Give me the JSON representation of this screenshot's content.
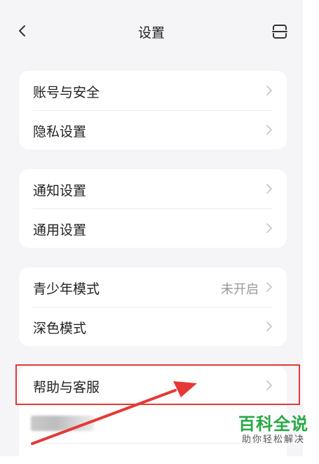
{
  "header": {
    "title": "设置",
    "back_icon": "chevron-left-icon",
    "scan_icon": "scan-icon"
  },
  "groups": [
    {
      "items": [
        {
          "label": "账号与安全",
          "value": ""
        },
        {
          "label": "隐私设置",
          "value": ""
        }
      ]
    },
    {
      "items": [
        {
          "label": "通知设置",
          "value": ""
        },
        {
          "label": "通用设置",
          "value": ""
        }
      ]
    },
    {
      "items": [
        {
          "label": "青少年模式",
          "value": "未开启"
        },
        {
          "label": "深色模式",
          "value": ""
        }
      ]
    },
    {
      "items": [
        {
          "label": "帮助与客服",
          "value": ""
        }
      ]
    }
  ],
  "annotation": {
    "highlight_color": "#e53935",
    "arrow_color": "#e53935"
  },
  "watermark": {
    "title": "百科全说",
    "subtitle": "助你轻松解决",
    "color": "#27a844"
  }
}
